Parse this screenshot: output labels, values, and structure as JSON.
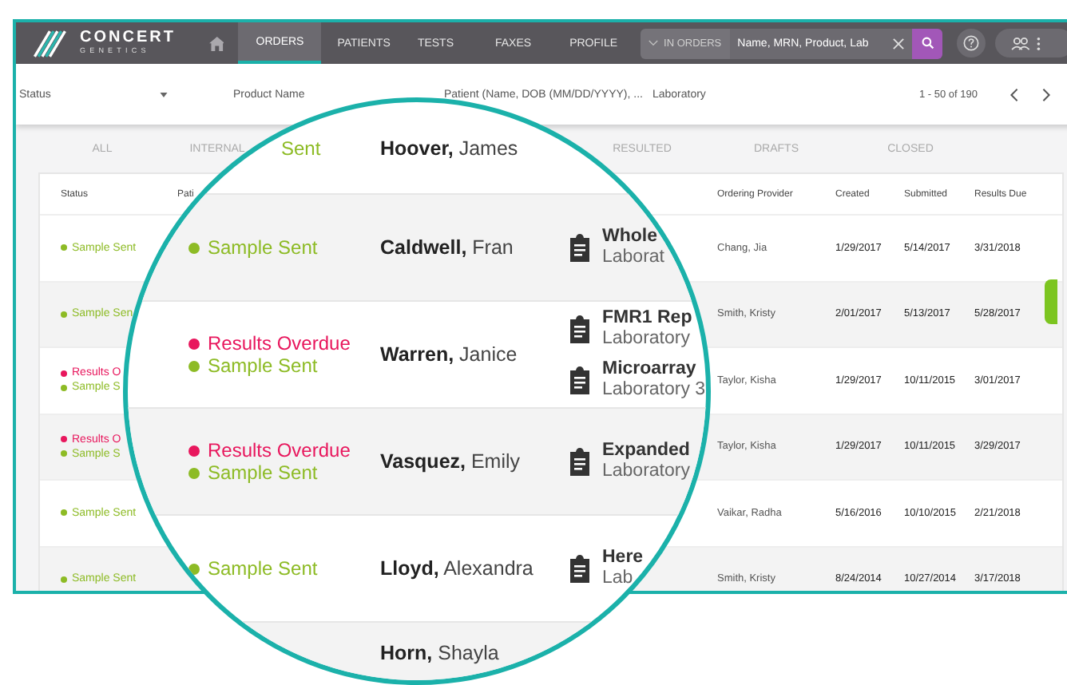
{
  "header": {
    "logo": {
      "name": "CONCERT",
      "tagline": "GENETICS"
    },
    "nav": [
      {
        "label": "ORDERS",
        "selected": true
      },
      {
        "label": "PATIENTS",
        "selected": false
      },
      {
        "label": "TESTS",
        "selected": false
      },
      {
        "label": "FAXES",
        "selected": false
      },
      {
        "label": "PROFILE",
        "selected": false
      }
    ],
    "search": {
      "scope": "IN ORDERS",
      "placeholder": "Name, MRN, Product, Lab"
    }
  },
  "filters": {
    "status": "Status",
    "product": "Product Name",
    "patient": "Patient (Name, DOB (MM/DD/YYYY), ...",
    "laboratory": "Laboratory",
    "range": "1 - 50 of 190"
  },
  "tabs": [
    {
      "label": "ALL",
      "selected": false
    },
    {
      "label": "INTERNAL",
      "selected": false
    },
    {
      "label": "RESULTED",
      "selected": false
    },
    {
      "label": "DRAFTS",
      "selected": false
    },
    {
      "label": "CLOSED",
      "selected": false
    }
  ],
  "table": {
    "columns": [
      "Status",
      "Pati",
      "Ordering Provider",
      "Created",
      "Submitted",
      "Results Due"
    ],
    "rows": [
      {
        "statuses": [
          {
            "label": "Sample Sent",
            "color": "#8dbb25"
          }
        ],
        "provider": "Chang, Jia",
        "created": "1/29/2017",
        "submitted": "5/14/2017",
        "due": "3/31/2018"
      },
      {
        "statuses": [
          {
            "label": "Sample Sen",
            "color": "#8dbb25"
          }
        ],
        "provider": "Smith, Kristy",
        "created": "2/01/2017",
        "submitted": "5/13/2017",
        "due": "5/28/2017"
      },
      {
        "statuses": [
          {
            "label": "Results O",
            "color": "#e8175d"
          },
          {
            "label": "Sample S",
            "color": "#8dbb25"
          }
        ],
        "provider": "Taylor, Kisha",
        "created": "1/29/2017",
        "submitted": "10/11/2015",
        "due": "3/01/2017"
      },
      {
        "statuses": [
          {
            "label": "Results O",
            "color": "#e8175d"
          },
          {
            "label": "Sample S",
            "color": "#8dbb25"
          }
        ],
        "provider": "Taylor, Kisha",
        "created": "1/29/2017",
        "submitted": "10/11/2015",
        "due": "3/29/2017"
      },
      {
        "statuses": [
          {
            "label": "Sample Sent",
            "color": "#8dbb25"
          }
        ],
        "provider": "Vaikar, Radha",
        "created": "5/16/2016",
        "submitted": "10/10/2015",
        "due": "2/21/2018"
      },
      {
        "statuses": [
          {
            "label": "Sample Sent",
            "color": "#8dbb25"
          }
        ],
        "provider": "Smith, Kristy",
        "created": "8/24/2014",
        "submitted": "10/27/2014",
        "due": "3/17/2018"
      }
    ]
  },
  "magnifier": {
    "rows": [
      {
        "statuses": [
          {
            "label": "Sent",
            "color": "#8dbb25"
          }
        ],
        "patient": "**Hoover,** James",
        "products": []
      },
      {
        "statuses": [
          {
            "label": "Sample Sent",
            "color": "#8dbb25"
          }
        ],
        "patient": "**Caldwell,** Fran",
        "products": [
          {
            "name": "Whole",
            "lab": "Laborat"
          }
        ]
      },
      {
        "statuses": [
          {
            "label": "Results Overdue",
            "color": "#e8175d"
          },
          {
            "label": "Sample Sent",
            "color": "#8dbb25"
          }
        ],
        "patient": "**Warren,** Janice",
        "products": [
          {
            "name": "FMR1 Rep",
            "lab": "Laboratory"
          },
          {
            "name": "Microarray",
            "lab": "Laboratory 3"
          }
        ]
      },
      {
        "statuses": [
          {
            "label": "Results Overdue",
            "color": "#e8175d"
          },
          {
            "label": "Sample Sent",
            "color": "#8dbb25"
          }
        ],
        "patient": "**Vasquez,** Emily",
        "products": [
          {
            "name": "Expanded",
            "lab": "Laboratory"
          }
        ]
      },
      {
        "statuses": [
          {
            "label": "Sample Sent",
            "color": "#8dbb25"
          }
        ],
        "patient": "**Lloyd,** Alexandra",
        "products": [
          {
            "name": "Here",
            "lab": "Lab"
          }
        ]
      },
      {
        "statuses": [],
        "patient": "**Horn,** Shayla",
        "products": []
      }
    ]
  }
}
